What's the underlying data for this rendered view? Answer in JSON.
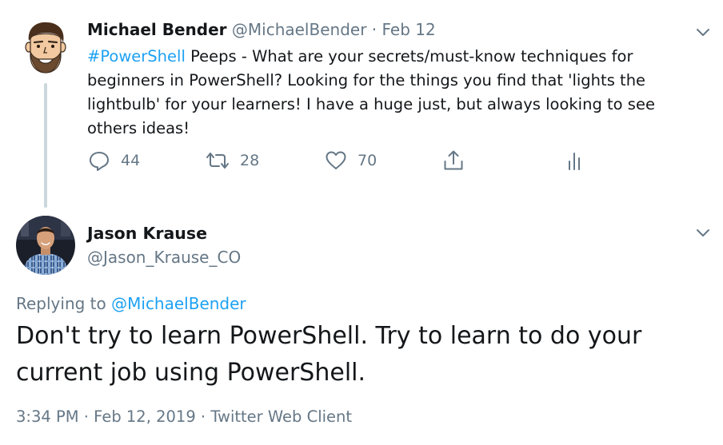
{
  "parent_tweet": {
    "author_name": "Michael Bender",
    "author_handle": "@MichaelBender",
    "separator": "·",
    "date": "Feb 12",
    "hashtag": "#PowerShell",
    "text": " Peeps - What are your secrets/must-know techniques for beginners in PowerShell? Looking for the things you find that 'lights the lightbulb' for your learners! I have a huge just, but always looking to see others ideas!",
    "reply_count": "44",
    "retweet_count": "28",
    "like_count": "70"
  },
  "reply_tweet": {
    "author_name": "Jason Krause",
    "author_handle": "@Jason_Krause_CO",
    "replying_prefix": "Replying to ",
    "replying_mention": "@MichaelBender",
    "text": "Don't try to learn PowerShell. Try to learn to do your current job using PowerShell.",
    "meta": "3:34 PM · Feb 12, 2019 · Twitter Web Client"
  },
  "icons": [
    "avatar-cartoon",
    "avatar-photo",
    "chevron-down-icon",
    "reply-icon",
    "retweet-icon",
    "like-icon",
    "share-icon",
    "analytics-icon"
  ],
  "colors": {
    "link": "#1da1f2",
    "secondary_text": "#657786",
    "primary_text": "#14171a",
    "thread_line": "#ccd6dd"
  }
}
